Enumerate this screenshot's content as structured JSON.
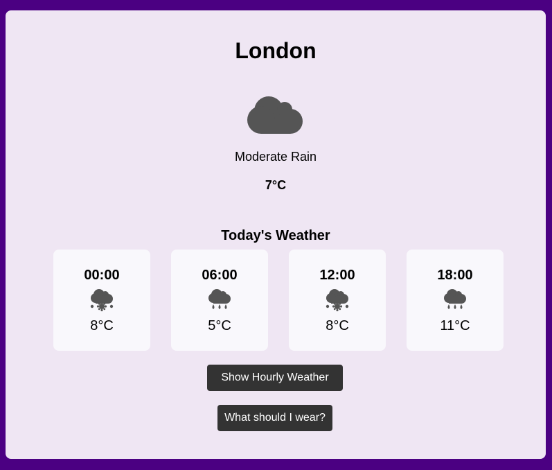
{
  "location": {
    "city": "London",
    "icon": "cloud-icon",
    "condition": "Moderate Rain",
    "temperature": "7°C"
  },
  "today": {
    "title": "Today's Weather",
    "forecasts": [
      {
        "time": "00:00",
        "icon": "snow-cloud-icon",
        "temp": "8°C"
      },
      {
        "time": "06:00",
        "icon": "rain-cloud-icon",
        "temp": "5°C"
      },
      {
        "time": "12:00",
        "icon": "snow-cloud-icon",
        "temp": "8°C"
      },
      {
        "time": "18:00",
        "icon": "rain-cloud-icon",
        "temp": "11°C"
      }
    ]
  },
  "buttons": {
    "hourly_label": "Show Hourly Weather",
    "wear_label": "What should I wear?"
  },
  "colors": {
    "background": "#4b0082",
    "card": "#efe6f3",
    "tile": "#f9f8fc",
    "icon": "#555555",
    "button": "#333333",
    "button_text": "#ffffff"
  }
}
